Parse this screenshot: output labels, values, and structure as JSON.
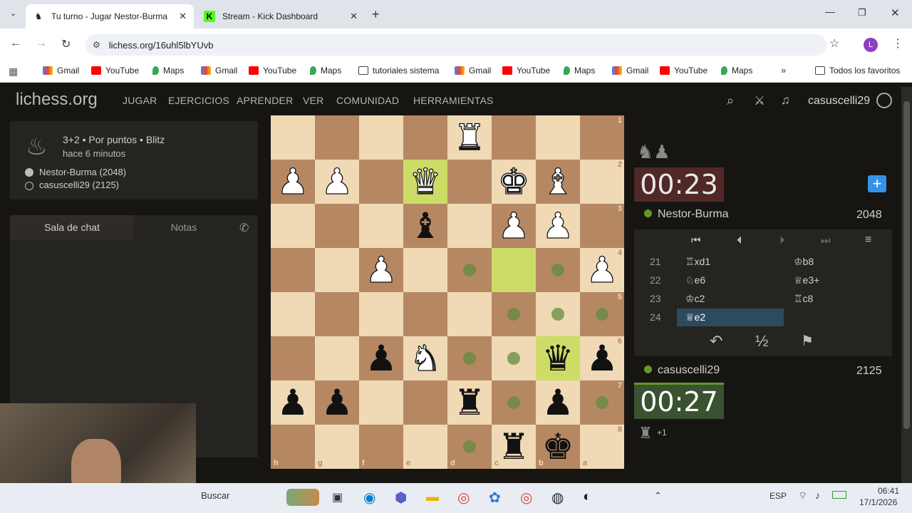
{
  "browser": {
    "tabs": [
      {
        "title": "Tu turno - Jugar Nestor-Burma",
        "active": true
      },
      {
        "title": "Stream - Kick Dashboard",
        "active": false
      }
    ],
    "url": "lichess.org/16uhl5lbYUvb",
    "profile_letter": "L",
    "bookmarks": [
      "Gmail",
      "YouTube",
      "Maps",
      "Gmail",
      "YouTube",
      "Maps",
      "tutoriales sistema",
      "Gmail",
      "YouTube",
      "Maps",
      "Gmail",
      "YouTube",
      "Maps"
    ],
    "all_bookmarks": "Todos los favoritos"
  },
  "site": {
    "logo": "lichess.org",
    "nav": [
      "JUGAR",
      "EJERCICIOS",
      "APRENDER",
      "VER",
      "COMUNIDAD",
      "HERRAMIENTAS"
    ],
    "username": "casuscelli29"
  },
  "game": {
    "type": "3+2 • Por puntos • Blitz",
    "time_ago": "hace 6 minutos",
    "white_player": "Nestor-Burma (2048)",
    "black_player": "casuscelli29 (2125)"
  },
  "chat": {
    "tab_chat": "Sala de chat",
    "tab_notes": "Notas"
  },
  "board": {
    "ranks": [
      "1",
      "2",
      "3",
      "4",
      "5",
      "6",
      "7",
      "8"
    ],
    "files": [
      "h",
      "g",
      "f",
      "e",
      "d",
      "c",
      "b",
      "a"
    ]
  },
  "opponent": {
    "name": "Nestor-Burma",
    "rating": "2048",
    "clock": "00:23"
  },
  "player": {
    "name": "casuscelli29",
    "rating": "2125",
    "clock": "00:27",
    "material": "+1"
  },
  "moves": [
    {
      "n": "21",
      "w": "♖xd1",
      "b": "♔b8"
    },
    {
      "n": "22",
      "w": "♘e6",
      "b": "♕e3+"
    },
    {
      "n": "23",
      "w": "♔c2",
      "b": "♖c8"
    },
    {
      "n": "24",
      "w": "♕e2",
      "b": ""
    }
  ],
  "controls": {
    "draw": "½"
  },
  "taskbar": {
    "search": "Buscar",
    "lang": "ESP",
    "time": "06:41",
    "date": "17/1/2026"
  }
}
